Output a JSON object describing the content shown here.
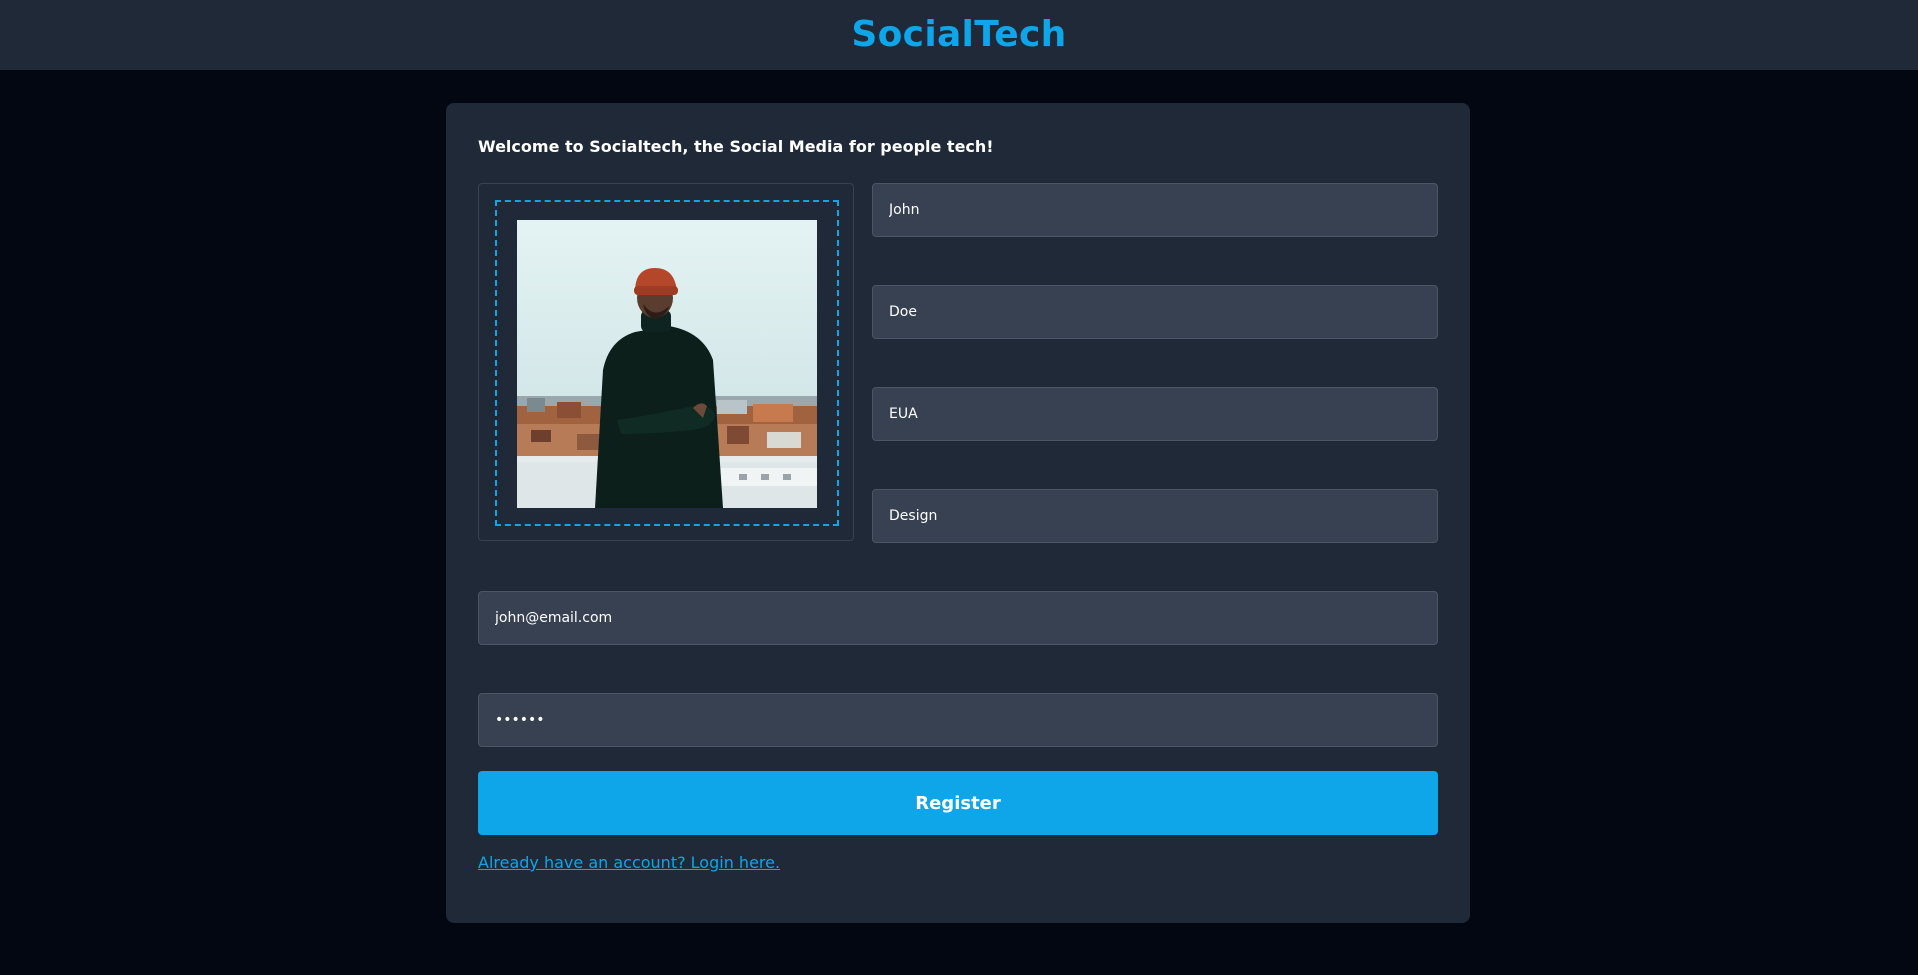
{
  "header": {
    "brand": "SocialTech"
  },
  "form": {
    "welcome": "Welcome to Socialtech, the Social Media for people tech!",
    "first_name": "John",
    "last_name": "Doe",
    "country": "EUA",
    "area": "Design",
    "email": "john@email.com",
    "password": "••••••",
    "register_label": "Register",
    "login_link": "Already have an account? Login here."
  },
  "colors": {
    "accent": "#0ea5e9",
    "page_bg": "#030712",
    "card_bg": "#1f2937",
    "input_bg": "#374151"
  },
  "photo": {
    "description_icon": "profile-photo"
  }
}
